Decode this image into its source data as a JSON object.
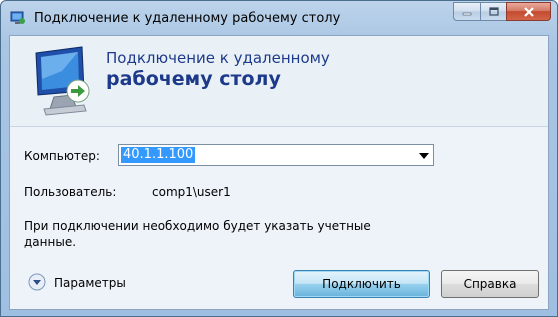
{
  "window": {
    "title": "Подключение к удаленному рабочему столу"
  },
  "banner": {
    "line1": "Подключение к удаленному",
    "line2": "рабочему столу"
  },
  "form": {
    "computer_label": "Компьютер:",
    "computer_value": "40.1.1.100",
    "user_label": "Пользователь:",
    "user_value": "comp1\\user1",
    "note": "При подключении необходимо будет указать учетные данные."
  },
  "footer": {
    "options_label": "Параметры",
    "connect_label": "Подключить",
    "help_label": "Справка"
  },
  "colors": {
    "accent": "#1d3a8a",
    "selection": "#3399ff",
    "close_button": "#c44a2f"
  },
  "icons": [
    "rdp-app-icon",
    "rdp-monitor-icon",
    "minimize-icon",
    "maximize-icon",
    "close-icon",
    "expand-options-icon"
  ]
}
